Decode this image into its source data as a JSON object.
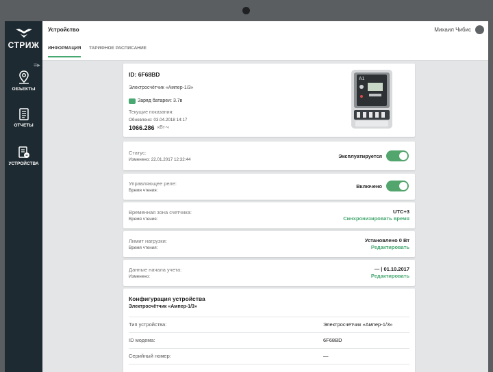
{
  "sidebar": {
    "logo_text": "СТРИЖ",
    "items": [
      {
        "label": "ОБЪЕКТЫ",
        "icon": "map-pin-icon"
      },
      {
        "label": "ОТЧЕТЫ",
        "icon": "document-icon"
      },
      {
        "label": "УСТРОЙСТВА",
        "icon": "device-icon"
      }
    ]
  },
  "header": {
    "title": "Устройство",
    "user_name": "Михаил Чибис",
    "tabs": [
      {
        "label": "ИНФОРМАЦИЯ",
        "active": true
      },
      {
        "label": "ТАРИФНОЕ РАСПИСАНИЕ",
        "active": false
      }
    ]
  },
  "device": {
    "id": "ID: 6F68BD",
    "name": "Электросчётчик «Ампер-1/3»",
    "battery": "Заряд батареи: 3.7в",
    "readings_label": "Текущие показания:",
    "updated": "Обновлено: 03.04.2018 14:17",
    "reading_value": "1066.286",
    "reading_unit": "кВт·ч"
  },
  "status": {
    "label": "Статус:",
    "changed": "Изменено: 22.01.2017 12:32:44",
    "value": "Эксплуатируется"
  },
  "relay": {
    "label": "Управляющее реле:",
    "read_time": "Время чтения:",
    "value": "Включено"
  },
  "timezone": {
    "label": "Временная зона счетчика:",
    "read_time": "Время чтения:",
    "value": "UTC+3",
    "action": "Синхронизировать время"
  },
  "load_limit": {
    "label": "Лимит нагрузки:",
    "read_time": "Время чтения:",
    "value": "Установлено 0 Вт",
    "action": "Редактировать"
  },
  "accounting_start": {
    "label": "Данные начала учета:",
    "changed": "Изменено:",
    "value": "— | 01.10.2017",
    "action": "Редактировать"
  },
  "config": {
    "title": "Конфигурация устройства",
    "subtitle": "Электросчётчик «Ампер-1/3»",
    "rows": [
      {
        "key": "Тип устройства:",
        "value": "Электросчётчик «Ампер-1/3»"
      },
      {
        "key": "ID модема:",
        "value": "6F68BD"
      },
      {
        "key": "Серийный номер:",
        "value": "—"
      }
    ]
  },
  "colors": {
    "accent": "#47a871",
    "sidebar": "#1e2a31",
    "background": "#e4e5e6"
  }
}
